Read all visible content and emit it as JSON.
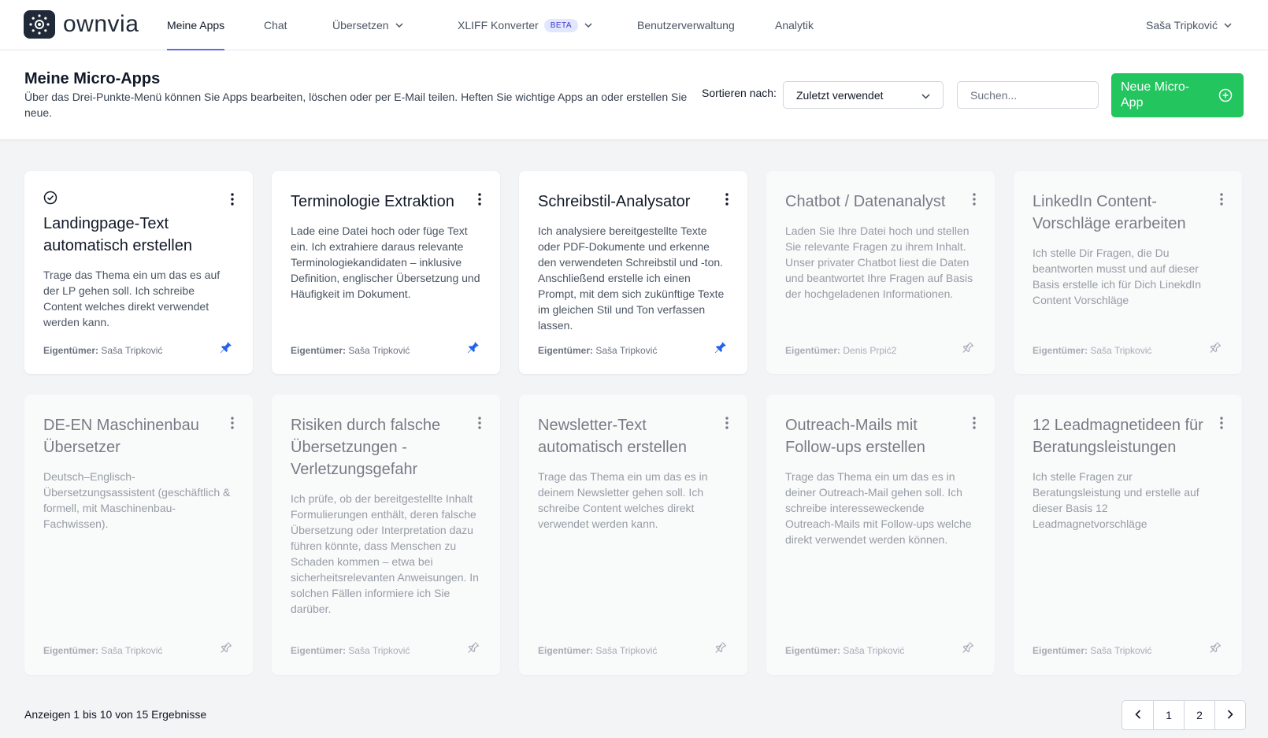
{
  "nav": {
    "logo_text": "ownvia",
    "items": [
      {
        "label": "Meine Apps"
      },
      {
        "label": "Chat"
      },
      {
        "label": "Übersetzen"
      },
      {
        "label": "XLIFF Konverter",
        "badge": "BETA"
      },
      {
        "label": "Benutzerverwaltung"
      },
      {
        "label": "Analytik"
      }
    ],
    "active_index": 0,
    "user_name": "Saša Tripković"
  },
  "header": {
    "title": "Meine Micro-Apps",
    "description": "Über das Drei-Punkte-Menü können Sie Apps bearbeiten, löschen oder per E-Mail teilen. Heften Sie wichtige Apps an oder erstellen Sie neue.",
    "sort_label": "Sortieren nach:",
    "sort_value": "Zuletzt verwendet",
    "search_placeholder": "Suchen...",
    "new_button_label": "Neue Micro-App"
  },
  "owner_prefix": "Eigentümer:",
  "cards": [
    {
      "title": "Landingpage-Text automatisch erstellen",
      "description": "Trage das Thema ein um das es auf der LP gehen soll. Ich schreibe Content welches direkt verwendet werden kann.",
      "owner": "Saša Tripković",
      "pinned": true,
      "verified": true
    },
    {
      "title": "Terminologie Extraktion",
      "description": "Lade eine Datei hoch oder füge Text ein. Ich extrahiere daraus relevante Terminologiekandidaten – inklusive Definition, englischer Übersetzung und Häufigkeit im Dokument.",
      "owner": "Saša Tripković",
      "pinned": true,
      "verified": false
    },
    {
      "title": "Schreibstil-Analysator",
      "description": "Ich analysiere bereitgestellte Texte oder PDF-Dokumente und erkenne den verwendeten Schreibstil und -ton. Anschließend erstelle ich einen Prompt, mit dem sich zukünftige Texte im gleichen Stil und Ton verfassen lassen.",
      "owner": "Saša Tripković",
      "pinned": true,
      "verified": false
    },
    {
      "title": "Chatbot / Datenanalyst",
      "description": "Laden Sie Ihre Datei hoch und stellen Sie relevante Fragen zu ihrem Inhalt. Unser privater Chatbot liest die Daten und beantwortet Ihre Fragen auf Basis der hochgeladenen Informationen.",
      "owner": "Denis Prpić2",
      "pinned": false,
      "verified": false
    },
    {
      "title": "LinkedIn Content-Vorschläge erarbeiten",
      "description": "Ich stelle Dir Fragen, die Du beantworten musst und auf dieser Basis erstelle ich für Dich LinekdIn Content Vorschläge",
      "owner": "Saša Tripković",
      "pinned": false,
      "verified": false
    },
    {
      "title": "DE-EN Maschinenbau Übersetzer",
      "description": "Deutsch–Englisch-Übersetzungsassistent (geschäftlich & formell, mit Maschinenbau-Fachwissen).",
      "owner": "Saša Tripković",
      "pinned": false,
      "verified": false
    },
    {
      "title": "Risiken durch falsche Übersetzungen - Verletzungsgefahr",
      "description": "Ich prüfe, ob der bereitgestellte Inhalt Formulierungen enthält, deren falsche Übersetzung oder Interpretation dazu führen könnte, dass Menschen zu Schaden kommen – etwa bei sicherheitsrelevanten Anweisungen. In solchen Fällen informiere ich Sie darüber.",
      "owner": "Saša Tripković",
      "pinned": false,
      "verified": false
    },
    {
      "title": "Newsletter-Text automatisch erstellen",
      "description": "Trage das Thema ein um das es in deinem Newsletter gehen soll. Ich schreibe Content welches direkt verwendet werden kann.",
      "owner": "Saša Tripković",
      "pinned": false,
      "verified": false
    },
    {
      "title": "Outreach-Mails mit Follow-ups erstellen",
      "description": "Trage das Thema ein um das es in deiner Outreach-Mail gehen soll. Ich schreibe interesseweckende Outreach-Mails mit Follow-ups welche direkt verwendet werden können.",
      "owner": "Saša Tripković",
      "pinned": false,
      "verified": false
    },
    {
      "title": "12 Leadmagnetideen für Beratungsleistungen",
      "description": "Ich stelle Fragen zur Beratungsleistung und erstelle auf dieser Basis 12 Leadmagnetvorschläge",
      "owner": "Saša Tripković",
      "pinned": false,
      "verified": false
    }
  ],
  "footer": {
    "results_text": "Anzeigen 1 bis 10 von 15 Ergebnisse",
    "pages": [
      "1",
      "2"
    ]
  },
  "colors": {
    "accent": "#6366f1",
    "primary_button": "#22c55e",
    "pin_active": "#2563eb",
    "beta_bg": "#e0e7ff"
  }
}
